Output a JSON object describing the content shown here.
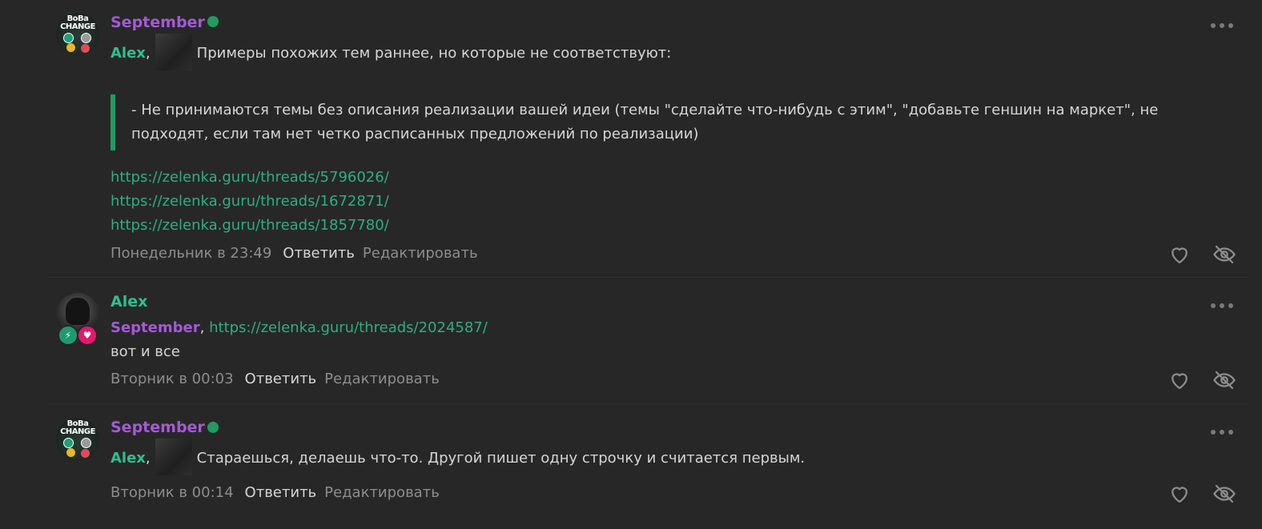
{
  "comments": [
    {
      "author": "September",
      "online": true,
      "mention": "Alex",
      "text": "Примеры похожих тем раннее, но которые не соответствуют:",
      "quote": "- Не принимаются темы без описания реализации вашей идеи (темы \"сделайте что-нибудь с этим\", \"добавьте геншин на маркет\", не подходят, если там нет четко расписанных предложений по реализации)",
      "links": [
        "https://zelenka.guru/threads/5796026/",
        "https://zelenka.guru/threads/1672871/",
        "https://zelenka.guru/threads/1857780/"
      ],
      "date": "Понедельник в 23:49",
      "reply_label": "Ответить",
      "edit_label": "Редактировать"
    },
    {
      "author": "Alex",
      "mention": "September",
      "link": "https://zelenka.guru/threads/2024587/",
      "text": "вот и все",
      "date": "Вторник в 00:03",
      "reply_label": "Ответить",
      "edit_label": "Редактировать"
    },
    {
      "author": "September",
      "online": true,
      "mention": "Alex",
      "text": "Стараешься, делаешь что-то. Другой пишет одну строчку и считается первым.",
      "date": "Вторник в 00:14",
      "reply_label": "Ответить",
      "edit_label": "Редактировать"
    }
  ],
  "avatar_text": {
    "line1": "BoBa",
    "line2": "CHANGE"
  },
  "icons": {
    "like": "heart-outline-icon",
    "hide": "eye-slash-icon",
    "more": "more-dots-icon",
    "badge1": "lightning-icon",
    "badge2": "heart-icon"
  },
  "colors": {
    "background": "#272727",
    "september": "#a45ad6",
    "alex": "#2fbf8f",
    "link": "#2fae80",
    "quote_bar": "#229a60",
    "online": "#229a60"
  }
}
